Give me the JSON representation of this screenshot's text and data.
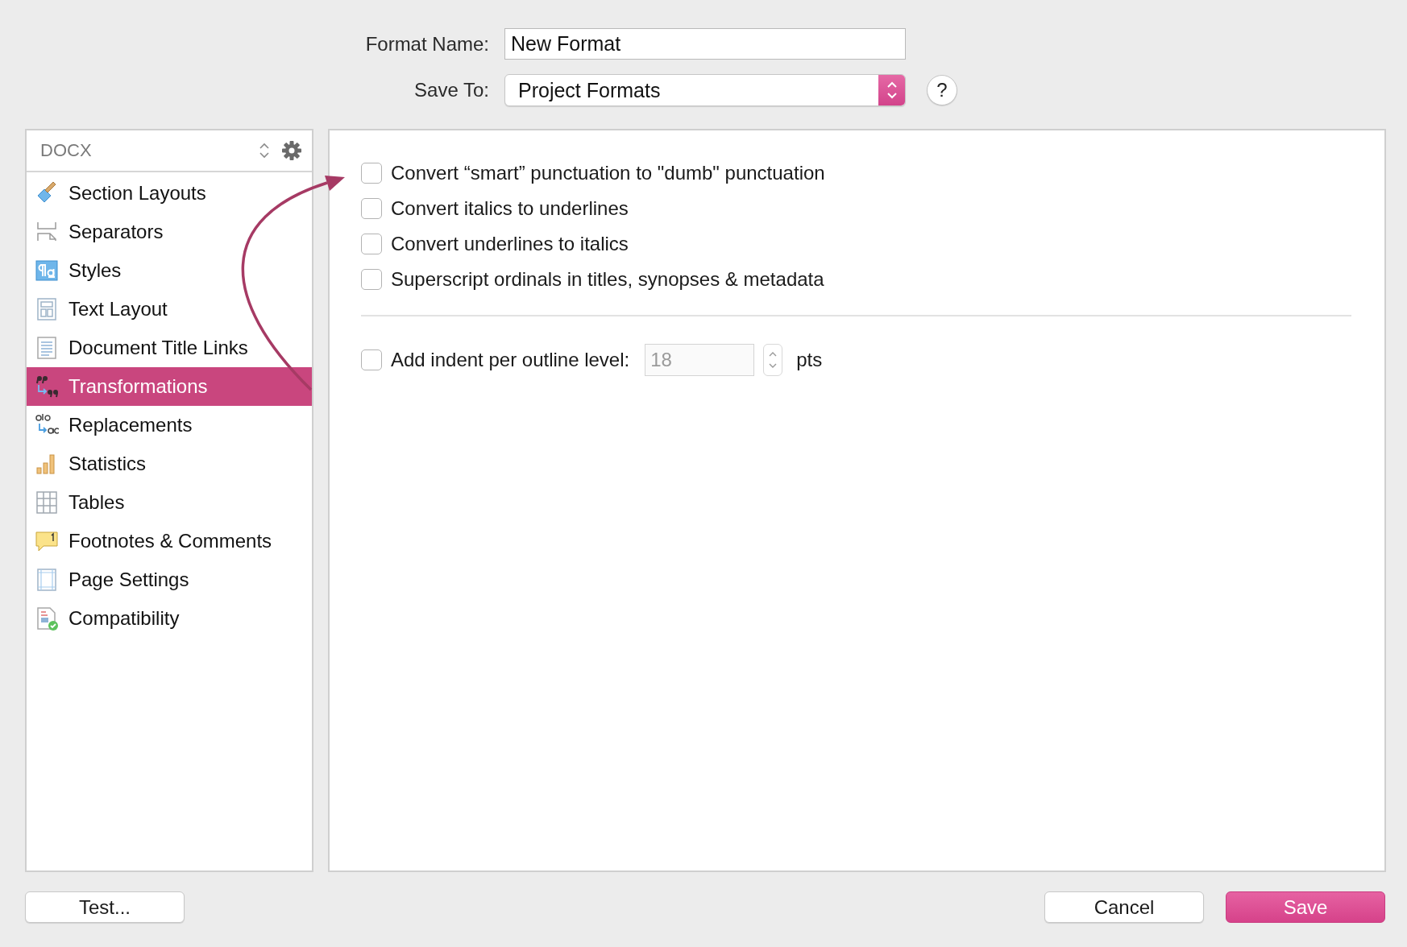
{
  "header": {
    "format_name": {
      "label": "Format Name:",
      "value": "New Format"
    },
    "save_to": {
      "label": "Save To:",
      "value": "Project Formats"
    },
    "help": "?"
  },
  "sidebar": {
    "format": "DOCX",
    "items": [
      {
        "label": "Section Layouts",
        "selected": false
      },
      {
        "label": "Separators",
        "selected": false
      },
      {
        "label": "Styles",
        "selected": false
      },
      {
        "label": "Text Layout",
        "selected": false
      },
      {
        "label": "Document Title Links",
        "selected": false
      },
      {
        "label": "Transformations",
        "selected": true
      },
      {
        "label": "Replacements",
        "selected": false
      },
      {
        "label": "Statistics",
        "selected": false
      },
      {
        "label": "Tables",
        "selected": false
      },
      {
        "label": "Footnotes & Comments",
        "selected": false
      },
      {
        "label": "Page Settings",
        "selected": false
      },
      {
        "label": "Compatibility",
        "selected": false
      }
    ]
  },
  "options": {
    "checkboxes": [
      {
        "label": "Convert “smart” punctuation to \"dumb\" punctuation",
        "checked": false
      },
      {
        "label": "Convert italics to underlines",
        "checked": false
      },
      {
        "label": "Convert underlines to italics",
        "checked": false
      },
      {
        "label": "Superscript ordinals in titles, synopses & metadata",
        "checked": false
      }
    ],
    "indent": {
      "label": "Add indent per outline level:",
      "checked": false,
      "value": "18",
      "disabled": true,
      "unit": "pts"
    }
  },
  "buttons": [
    {
      "label": "Test...",
      "kind": "plain"
    },
    {
      "label": "Cancel",
      "kind": "plain"
    },
    {
      "label": "Save",
      "kind": "default"
    }
  ]
}
